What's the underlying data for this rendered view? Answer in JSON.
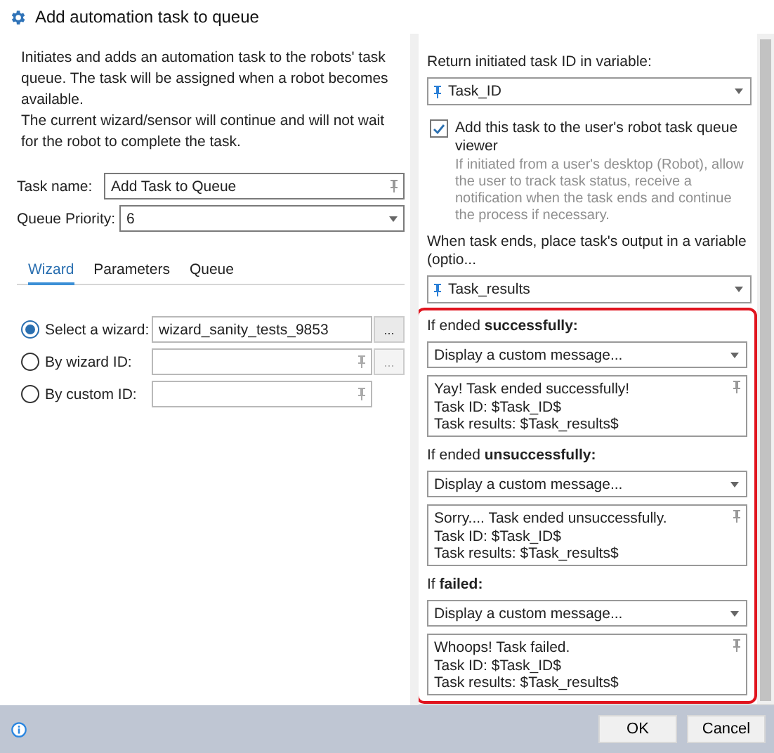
{
  "window": {
    "title": "Add automation task to queue"
  },
  "description": [
    "Initiates and adds an automation task to the robots' task queue. The task will be assigned when a robot becomes available.",
    "The current wizard/sensor will continue and will not wait for the robot to complete the task."
  ],
  "fields": [
    {
      "label": "Task name:",
      "value": "Add Task to Queue",
      "kind": "text"
    },
    {
      "label": "Queue Priority:",
      "value": "6",
      "kind": "dropdown"
    }
  ],
  "tabs": [
    {
      "label": "Wizard",
      "selected": true
    },
    {
      "label": "Parameters",
      "selected": false
    },
    {
      "label": "Queue",
      "selected": false
    }
  ],
  "wizard_options": [
    {
      "label": "Select a wizard:",
      "value": "wizard_sanity_tests_9853",
      "selected": true,
      "browse": {
        "label": "...",
        "disabled": false
      }
    },
    {
      "label": "By wizard ID:",
      "selected": false,
      "browse": {
        "label": "...",
        "disabled": true
      }
    },
    {
      "label": "By custom ID:",
      "selected": false
    }
  ],
  "return_id": {
    "label": "Return initiated task ID in variable:",
    "value": "Task_ID"
  },
  "queue_viewer": {
    "label": "Add this task to the user's robot task queue viewer",
    "checked": true,
    "description": "If initiated from a user's desktop (Robot), allow the user to track task status, receive a notification when the task ends and continue the process if necessary."
  },
  "output_variable": {
    "label": "When task ends, place task's output in a variable (optio...",
    "value": "Task_results"
  },
  "outcomes": [
    {
      "label": "If ended **successfully:**",
      "action": "Display a custom message...",
      "message": [
        "Yay! Task ended successfully!",
        "Task ID: $Task_ID$",
        "Task results: $Task_results$"
      ]
    },
    {
      "label": "If ended **unsuccessfully:**",
      "action": "Display a custom message...",
      "message": [
        "Sorry.... Task ended unsuccessfully.",
        "Task ID: $Task_ID$",
        "Task results: $Task_results$"
      ]
    },
    {
      "label": "If **failed:**",
      "action": "Display a custom message...",
      "message": [
        "Whoops! Task failed.",
        "Task ID: $Task_ID$",
        "Task results: $Task_results$"
      ]
    }
  ],
  "buttons": [
    "OK",
    "Cancel"
  ]
}
